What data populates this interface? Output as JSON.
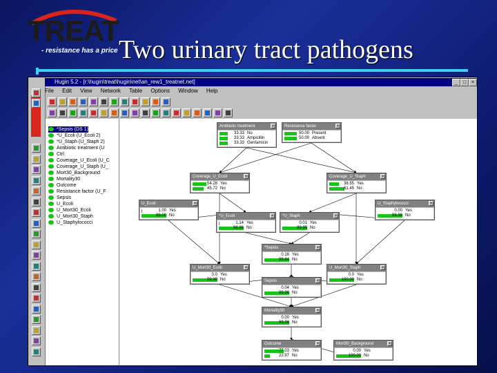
{
  "slide": {
    "title": "Two urinary tract pathogens",
    "logo_text": "TREAT",
    "logo_tagline": "- resistance has a price"
  },
  "app": {
    "window_title": "Hugin 5.2 - [r:\\hugin\\treat\\hugin\\net\\an_rew1_treatnet.net]",
    "menu": [
      "File",
      "Edit",
      "View",
      "Network",
      "Table",
      "Options",
      "Window",
      "Help"
    ],
    "vtoolbar_label": "Hugin Lite",
    "colors": {
      "bar": "#19c419",
      "title_bar": "#000080",
      "accent_rule": "#3fd0f0"
    }
  },
  "tree": {
    "items": [
      {
        "label": "*Sepsis (DS 1)",
        "selected": true
      },
      {
        "label": "*U_Ecoli (U_Ecoli 2)",
        "selected": false
      },
      {
        "label": "*U_Staph (U_Staph 2)",
        "selected": false
      },
      {
        "label": "Antibiotic treatment (U",
        "selected": false
      },
      {
        "label": "Ctrl",
        "selected": false
      },
      {
        "label": "Coverage_U_Ecoli (U_C",
        "selected": false
      },
      {
        "label": "Coverage_U_Staph (U_",
        "selected": false
      },
      {
        "label": "Mort30_Background",
        "selected": false
      },
      {
        "label": "Mortality30",
        "selected": false
      },
      {
        "label": "Outcome",
        "selected": false
      },
      {
        "label": "Resistance factor (U_F",
        "selected": false
      },
      {
        "label": "Sepsis",
        "selected": false
      },
      {
        "label": "U_Ecoli",
        "selected": false
      },
      {
        "label": "U_Mort30_Ecoli",
        "selected": false
      },
      {
        "label": "U_Mort30_Staph",
        "selected": false
      },
      {
        "label": "U_Staphylococci",
        "selected": false
      }
    ]
  },
  "nodes": [
    {
      "name": "Antibiotic treatment",
      "states": [
        {
          "value": "33.33",
          "label": "No",
          "p": 0.3333
        },
        {
          "value": "33.33",
          "label": "Ampicillin",
          "p": 0.3333
        },
        {
          "value": "33.33",
          "label": "Gentamicin",
          "p": 0.3333
        }
      ]
    },
    {
      "name": "Resistance factor",
      "states": [
        {
          "value": "50.00",
          "label": "Present",
          "p": 0.5
        },
        {
          "value": "50.00",
          "label": "Absent",
          "p": 0.5
        }
      ]
    },
    {
      "name": "Coverage_U_Ecoli",
      "states": [
        {
          "value": "54.28",
          "label": "Yes",
          "p": 0.5428
        },
        {
          "value": "45.72",
          "label": "No",
          "p": 0.4572
        }
      ]
    },
    {
      "name": "Coverage_U_Staph",
      "states": [
        {
          "value": "38.55",
          "label": "Yes",
          "p": 0.3855
        },
        {
          "value": "61.45",
          "label": "No",
          "p": 0.6145
        }
      ]
    },
    {
      "name": "U_Ecoli",
      "states": [
        {
          "value": "1.00",
          "label": "Yes",
          "p": 0.01
        },
        {
          "value": "99.00",
          "label": "No",
          "p": 0.99
        }
      ]
    },
    {
      "name": "*U_Ecoli",
      "states": [
        {
          "value": "1.14",
          "label": "Yes",
          "p": 0.0114
        },
        {
          "value": "98.86",
          "label": "No",
          "p": 0.9886
        }
      ]
    },
    {
      "name": "*U_Staph",
      "states": [
        {
          "value": "0.01",
          "label": "Yes",
          "p": 0.0001
        },
        {
          "value": "99.99",
          "label": "No",
          "p": 0.9999
        }
      ]
    },
    {
      "name": "U_Staphylococci",
      "states": [
        {
          "value": "0.00",
          "label": "Yes",
          "p": 0.0
        },
        {
          "value": "99.99",
          "label": "No",
          "p": 0.9999
        }
      ]
    },
    {
      "name": "*Sepsis",
      "states": [
        {
          "value": "0.16",
          "label": "Yes",
          "p": 0.0016
        },
        {
          "value": "99.84",
          "label": "No",
          "p": 0.9984
        }
      ]
    },
    {
      "name": "U_Mort30_Ecoli",
      "states": [
        {
          "value": "0.0",
          "label": "Yes",
          "p": 0.0
        },
        {
          "value": "99.99",
          "label": "No",
          "p": 0.9999
        }
      ]
    },
    {
      "name": "U_Mort30_Staph",
      "states": [
        {
          "value": "0.0",
          "label": "Yes",
          "p": 0.0
        },
        {
          "value": "100.00",
          "label": "No",
          "p": 1.0
        }
      ]
    },
    {
      "name": "Sepsis",
      "states": [
        {
          "value": "0.04",
          "label": "Yes",
          "p": 0.0004
        },
        {
          "value": "99.96",
          "label": "No",
          "p": 0.9996
        }
      ]
    },
    {
      "name": "Mortality30",
      "states": [
        {
          "value": "0.00",
          "label": "Yes",
          "p": 0.0
        },
        {
          "value": "99.99",
          "label": "No",
          "p": 0.9999
        }
      ]
    },
    {
      "name": "Outcome",
      "states": [
        {
          "value": "77.03",
          "label": "Yes",
          "p": 0.7703
        },
        {
          "value": "22.97",
          "label": "No",
          "p": 0.2297
        }
      ]
    },
    {
      "name": "Mort30_Background",
      "states": [
        {
          "value": "0.00",
          "label": "Yes",
          "p": 0.0
        },
        {
          "value": "100.00",
          "label": "No",
          "p": 1.0
        }
      ]
    }
  ]
}
